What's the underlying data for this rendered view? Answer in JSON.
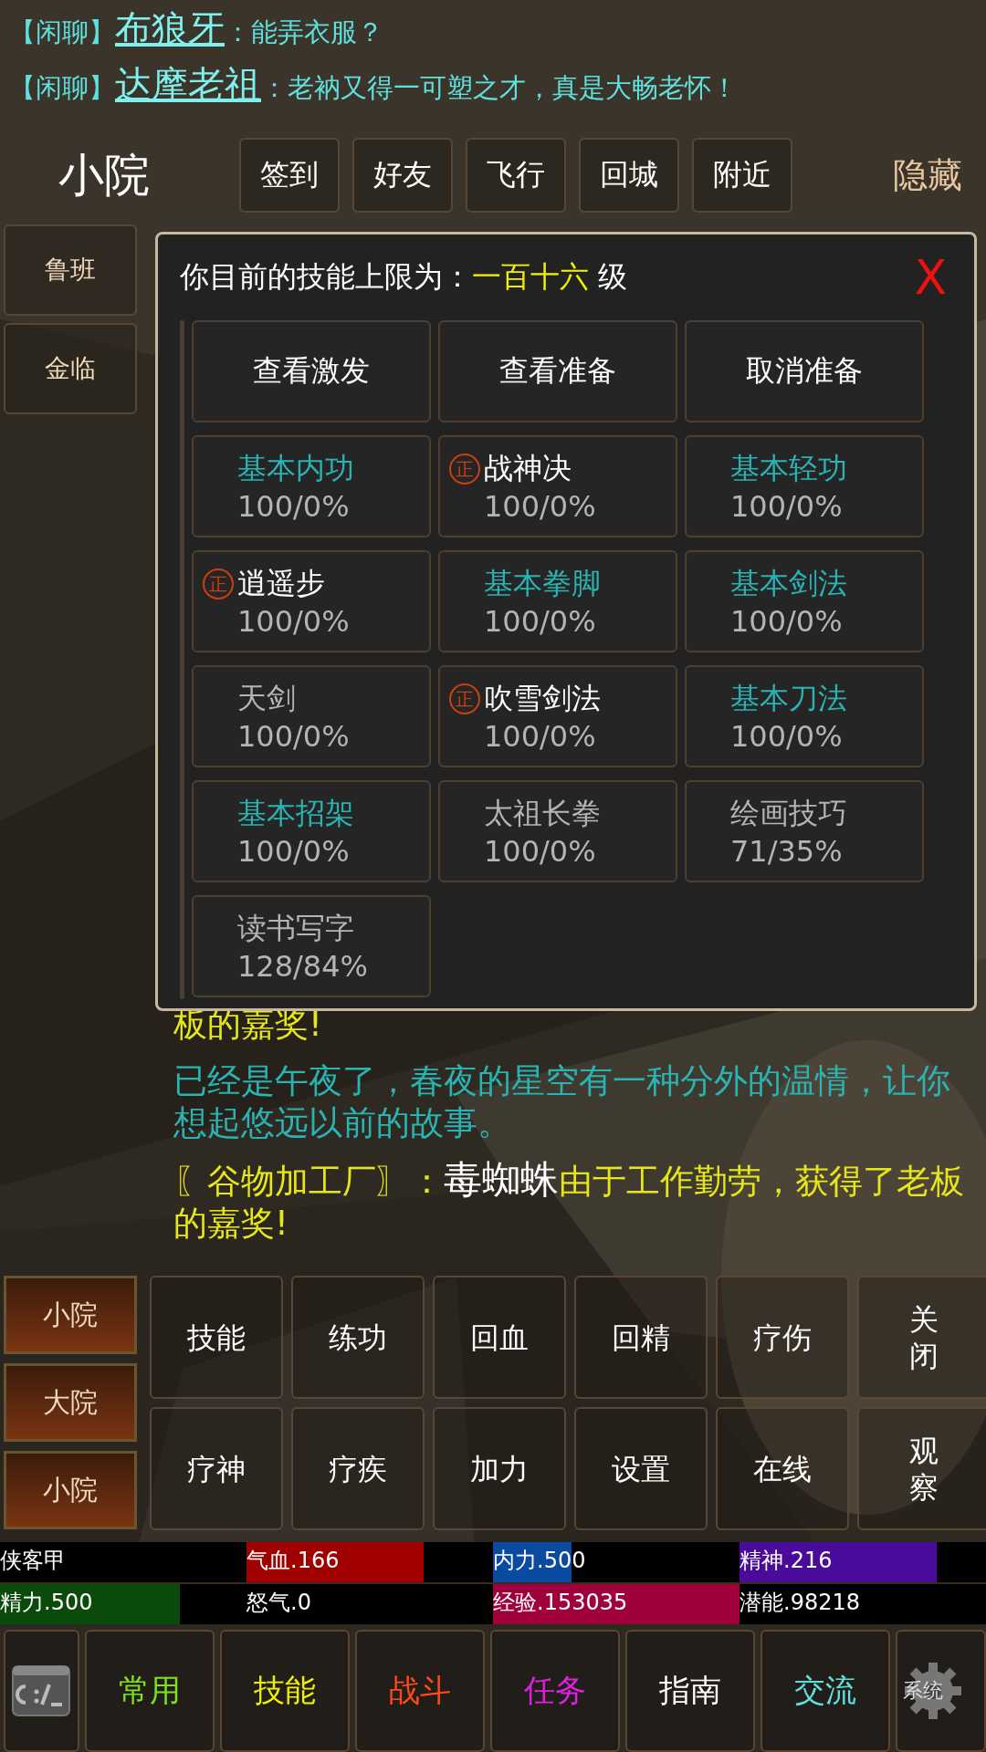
{
  "chat_top": [
    {
      "channel": "【闲聊】",
      "name": "布狼牙",
      "message": "：能弄衣服？"
    },
    {
      "channel": "【闲聊】",
      "name": "达摩老祖",
      "message": "：老衲又得一可塑之才，真是大畅老怀！"
    }
  ],
  "header": {
    "location": "小院",
    "buttons": [
      "签到",
      "好友",
      "飞行",
      "回城",
      "附近"
    ],
    "hide": "隐藏"
  },
  "side_places": [
    "鲁班",
    "金临"
  ],
  "skill_dialog": {
    "title": "你目前的技能上限为：",
    "level": "一百十六",
    "unit": "级",
    "close": "X",
    "commands": [
      "查看激发",
      "查看准备",
      "取消准备"
    ],
    "skills": [
      {
        "name": "基本内功",
        "progress": "100/0%",
        "color": "#2ab3b3"
      },
      {
        "name": "战神决",
        "progress": "100/0%",
        "color": "#ffffff",
        "badge": "正"
      },
      {
        "name": "基本轻功",
        "progress": "100/0%",
        "color": "#2ab3b3"
      },
      {
        "name": "逍遥步",
        "progress": "100/0%",
        "color": "#ffffff",
        "badge": "正"
      },
      {
        "name": "基本拳脚",
        "progress": "100/0%",
        "color": "#2ab3b3"
      },
      {
        "name": "基本剑法",
        "progress": "100/0%",
        "color": "#2ab3b3"
      },
      {
        "name": "天剑",
        "progress": "100/0%",
        "color": "#b4b4b4"
      },
      {
        "name": "吹雪剑法",
        "progress": "100/0%",
        "color": "#ffffff",
        "badge": "正"
      },
      {
        "name": "基本刀法",
        "progress": "100/0%",
        "color": "#2ab3b3"
      },
      {
        "name": "基本招架",
        "progress": "100/0%",
        "color": "#2ab3b3"
      },
      {
        "name": "太祖长拳",
        "progress": "100/0%",
        "color": "#b4b4b4"
      },
      {
        "name": "绘画技巧",
        "progress": "71/35%",
        "color": "#b4b4b4"
      },
      {
        "name": "读书写字",
        "progress": "128/84%",
        "color": "#b4b4b4"
      }
    ]
  },
  "chat_log": [
    {
      "kind": "notice",
      "text": "板的嘉奖!",
      "color": "#e6e619"
    },
    {
      "kind": "notice",
      "text": "已经是午夜了，春夜的星空有一种分外的温情，让你想起悠远以前的故事。",
      "color": "#2ab3b3"
    },
    {
      "kind": "reward",
      "place": "〖谷物加工厂〗：",
      "person": "毒蜘蛛",
      "text": "由于工作勤劳，获得了老板的嘉奖!"
    }
  ],
  "places": [
    "小院",
    "大院",
    "小院"
  ],
  "actions": [
    {
      "label": "技能",
      "kind": "plain"
    },
    {
      "label": "练功",
      "kind": "plain"
    },
    {
      "label": "回血",
      "kind": "plain"
    },
    {
      "label": "回精",
      "kind": "plain"
    },
    {
      "label": "疗伤",
      "kind": "plain"
    },
    {
      "label": "关闭",
      "kind": "stacked"
    },
    {
      "label": "疗神",
      "kind": "plain"
    },
    {
      "label": "疗疾",
      "kind": "plain"
    },
    {
      "label": "加力",
      "kind": "plain"
    },
    {
      "label": "设置",
      "kind": "plain"
    },
    {
      "label": "在线",
      "kind": "plain"
    },
    {
      "label": "观察",
      "kind": "stacked"
    }
  ],
  "stats": [
    {
      "kind": "name",
      "label": "侠客甲"
    },
    {
      "kind": "bar",
      "label": "气血.166",
      "level": 0.72,
      "color": "#a00000"
    },
    {
      "kind": "bar",
      "label": "内力.500",
      "level": 0.32,
      "color": "#0a4aa0"
    },
    {
      "kind": "bar",
      "label": "精神.216",
      "level": 0.8,
      "color": "#4a0a9a"
    },
    {
      "kind": "bar",
      "label": "精力.500",
      "level": 0.73,
      "color": "#0a4a0a"
    },
    {
      "kind": "bar",
      "label": "怒气.0"
    },
    {
      "kind": "bar",
      "label": "经验.153035",
      "level": 1,
      "color": "#a0003c"
    },
    {
      "kind": "bar",
      "label": "潜能.98218"
    }
  ],
  "nav": [
    {
      "kind": "console"
    },
    {
      "kind": "tab",
      "label": "常用",
      "color": "#7fe01e"
    },
    {
      "kind": "tab",
      "label": "技能",
      "color": "#f0f000"
    },
    {
      "kind": "tab",
      "label": "战斗",
      "color": "#ff4a1a"
    },
    {
      "kind": "tab",
      "label": "任务",
      "color": "#e020e0"
    },
    {
      "kind": "tab",
      "label": "指南",
      "color": "#ffffff"
    },
    {
      "kind": "tab",
      "label": "交流",
      "color": "#5ee0e0"
    },
    {
      "kind": "system",
      "label": "系统"
    }
  ]
}
